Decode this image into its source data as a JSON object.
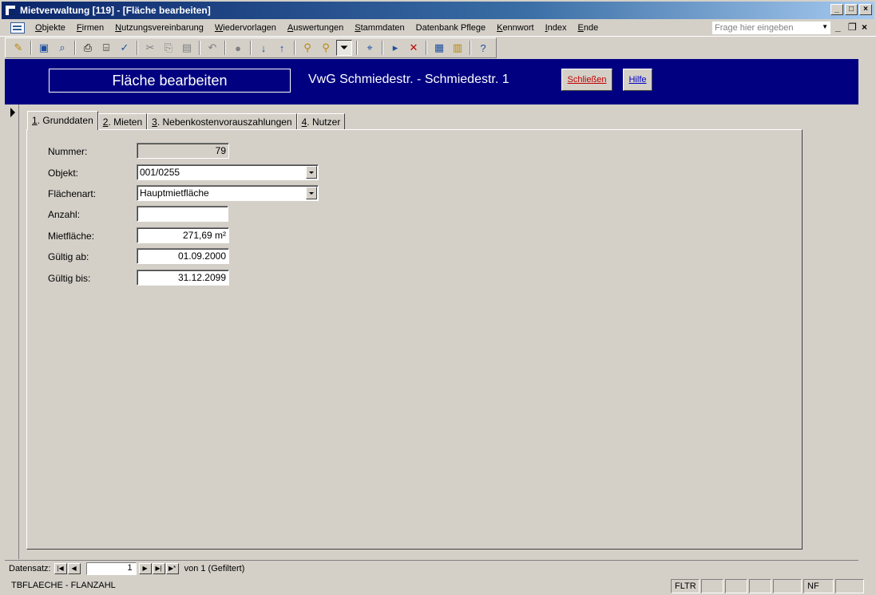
{
  "window": {
    "title": "Mietverwaltung [119] - [Fläche bearbeiten]"
  },
  "menu": {
    "items": [
      {
        "label": "Objekte",
        "key": "O",
        "rest": "bjekte"
      },
      {
        "label": "Firmen",
        "key": "F",
        "rest": "irmen"
      },
      {
        "label": "Nutzungsvereinbarung",
        "key": "N",
        "rest": "utzungsvereinbarung"
      },
      {
        "label": "Wiedervorlagen",
        "key": "W",
        "rest": "iedervorlagen"
      },
      {
        "label": "Auswertungen",
        "key": "A",
        "rest": "uswertungen"
      },
      {
        "label": "Stammdaten",
        "key": "S",
        "rest": "tammdaten"
      },
      {
        "label": "Datenbank Pflege",
        "key": "",
        "rest": "Datenbank Pflege"
      },
      {
        "label": "Kennwort",
        "key": "K",
        "rest": "ennwort"
      },
      {
        "label": "Index",
        "key": "I",
        "rest": "ndex"
      },
      {
        "label": "Ende",
        "key": "E",
        "rest": "nde"
      }
    ],
    "help_placeholder": "Frage hier eingeben"
  },
  "toolbar": {
    "icons": [
      "design-view-icon",
      "save-icon",
      "search-icon",
      "print-icon",
      "print-preview-icon",
      "spelling-icon",
      "cut-icon",
      "copy-icon",
      "paste-icon",
      "undo-icon",
      "hyperlink-icon",
      "sort-ascending-icon",
      "sort-descending-icon",
      "filter-by-selection-icon",
      "filter-by-form-icon",
      "apply-filter-icon",
      "find-icon",
      "new-record-icon",
      "delete-record-icon",
      "database-window-icon",
      "new-object-icon",
      "help-icon"
    ]
  },
  "header": {
    "form_title": "Fläche bearbeiten",
    "subtitle": "VwG Schmiedestr. - Schmiedestr. 1",
    "close_label": "Schließen",
    "help_label": "Hilfe"
  },
  "tabs": [
    {
      "num": "1",
      "label": ". Grunddaten"
    },
    {
      "num": "2",
      "label": ". Mieten"
    },
    {
      "num": "3",
      "label": ". Nebenkostenvorauszahlungen"
    },
    {
      "num": "4",
      "label": ". Nutzer"
    }
  ],
  "fields": {
    "nummer": {
      "label": "Nummer:",
      "value": "79"
    },
    "objekt": {
      "label": "Objekt:",
      "value": "001/0255"
    },
    "flaechenart": {
      "label": "Flächenart:",
      "value": "Hauptmietfläche"
    },
    "anzahl": {
      "label": "Anzahl:",
      "value": ""
    },
    "mietflaeche": {
      "label": "Mietfläche:",
      "value": "271,69 m²"
    },
    "gueltig_ab": {
      "label": "Gültig ab:",
      "value": "01.09.2000"
    },
    "gueltig_bis": {
      "label": "Gültig bis:",
      "value": "31.12.2099"
    }
  },
  "navigation": {
    "label": "Datensatz:",
    "current": "1",
    "of_text": "von  1 (Gefiltert)"
  },
  "status": {
    "left": "TBFLAECHE - FLANZAHL",
    "fltr": "FLTR",
    "nf": "NF"
  }
}
